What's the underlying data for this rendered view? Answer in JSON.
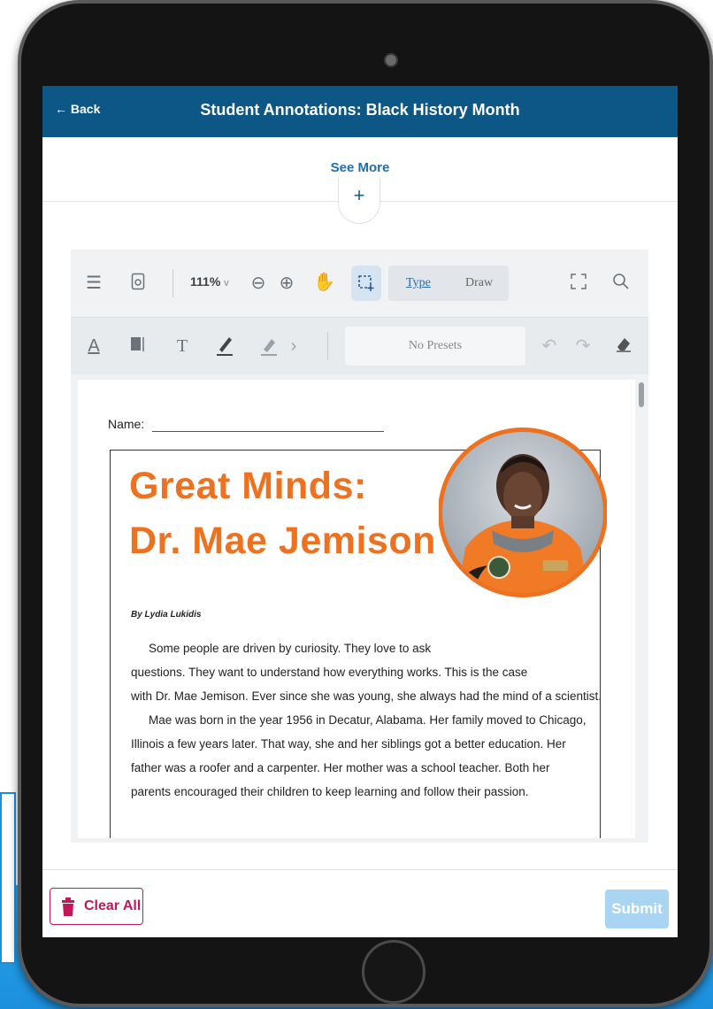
{
  "header": {
    "back_label": "Back",
    "title": "Student Annotations: Black History Month"
  },
  "see_more": {
    "label": "See More",
    "toggle_symbol": "+"
  },
  "toolbar": {
    "zoom_level": "111%",
    "zoom_caret": "v",
    "type_tab": "Type",
    "draw_tab": "Draw",
    "presets_placeholder": "No Presets",
    "icons": [
      "menu-icon",
      "page-settings-icon",
      "zoom-out-icon",
      "zoom-in-icon",
      "pan-hand-icon",
      "area-select-icon",
      "fullscreen-icon",
      "search-icon",
      "text-color-icon",
      "text-box-icon",
      "text-tool-icon",
      "highlighter-icon",
      "pen-icon",
      "chevron-right-icon",
      "undo-icon",
      "redo-icon",
      "eraser-icon"
    ]
  },
  "document": {
    "name_label": "Name:",
    "title_line1": "Great Minds:",
    "title_line2": "Dr. Mae Jemison",
    "byline": "By Lydia Lukidis",
    "paragraphs": [
      "Some people are driven by curiosity. They love to ask",
      "questions. They want to understand how everything works. This is the case",
      "with Dr. Mae Jemison. Ever since she was young, she always had the mind of a scientist.",
      "Mae was born in the year 1956 in Decatur, Alabama. Her family moved to Chicago,",
      "Illinois a few years later. That way, she and her siblings got a better education. Her",
      "father was a roofer and a carpenter. Her mother was a school teacher. Both her",
      "parents encouraged their children to keep learning and follow their passion."
    ]
  },
  "footer": {
    "clear_label": "Clear All",
    "submit_label": "Submit"
  },
  "colors": {
    "header_bg": "#0d5787",
    "accent_orange": "#ee7120",
    "clear_red": "#c2185b",
    "submit_disabled": "#a9d4f2"
  }
}
